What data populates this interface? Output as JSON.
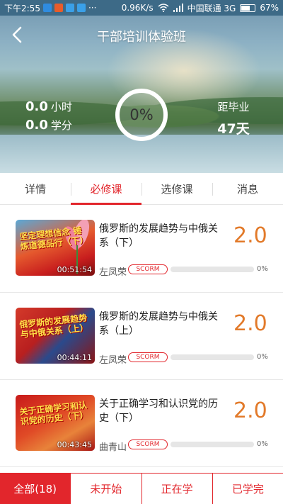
{
  "status_bar": {
    "time": "下午2:55",
    "network_speed": "0.96K/s",
    "carrier": "中国联通 3G",
    "battery": "67%",
    "battery_level": 0.67
  },
  "header": {
    "title": "干部培训体验班",
    "back_icon": "chevron-left-icon"
  },
  "summary": {
    "hours_value": "0.0",
    "hours_unit": "小时",
    "credits_value": "0.0",
    "credits_unit": "学分",
    "progress_text": "0%",
    "progress_fraction": 0,
    "graduation_label": "距毕业",
    "graduation_days": "47天"
  },
  "tabs": [
    {
      "label": "详情",
      "active": false
    },
    {
      "label": "必修课",
      "active": true
    },
    {
      "label": "选修课",
      "active": false
    },
    {
      "label": "消息",
      "active": false
    }
  ],
  "courses": [
    {
      "title": "俄罗斯的发展趋势与中俄关系（下）",
      "thumb_text": "坚定理想信念 锤炼道德品行（下）",
      "duration": "00:51:54",
      "teacher": "左凤荣",
      "badge": "SCORM",
      "score": "2.0",
      "progress_text": "0%",
      "progress_fraction": 0
    },
    {
      "title": "俄罗斯的发展趋势与中俄关系（上）",
      "thumb_text": "俄罗斯的发展趋势与中俄关系（上）",
      "duration": "00:44:11",
      "teacher": "左凤荣",
      "badge": "SCORM",
      "score": "2.0",
      "progress_text": "0%",
      "progress_fraction": 0
    },
    {
      "title": "关于正确学习和认识党的历史（下）",
      "thumb_text": "关于正确学习和认识党的历史（下）",
      "duration": "00:43:45",
      "teacher": "曲青山",
      "badge": "SCORM",
      "score": "2.0",
      "progress_text": "0%",
      "progress_fraction": 0
    }
  ],
  "filters": [
    {
      "label": "全部(18)",
      "active": true
    },
    {
      "label": "未开始",
      "active": false
    },
    {
      "label": "正在学",
      "active": false
    },
    {
      "label": "已学完",
      "active": false
    }
  ],
  "colors": {
    "accent": "#e2262c",
    "score": "#e27a2a",
    "status_bar": "#3d6a87"
  }
}
